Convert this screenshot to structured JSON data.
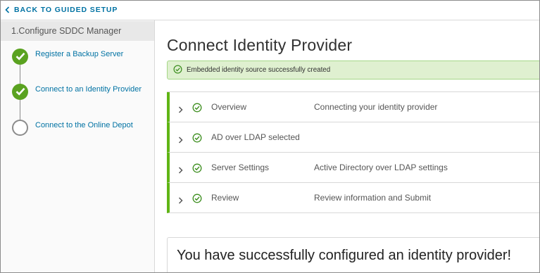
{
  "header": {
    "back_label": "BACK TO GUIDED SETUP"
  },
  "sidebar": {
    "section_title": "1.Configure SDDC Manager",
    "steps": [
      {
        "label": "Register a Backup Server",
        "status": "complete"
      },
      {
        "label": "Connect to an Identity Provider",
        "status": "complete"
      },
      {
        "label": "Connect to the Online Depot",
        "status": "not-started"
      }
    ]
  },
  "main": {
    "title": "Connect Identity Provider",
    "alert": "Embedded identity source successfully created",
    "accordion": [
      {
        "title": "Overview",
        "description": "Connecting your identity provider"
      },
      {
        "title": "AD over LDAP selected",
        "description": ""
      },
      {
        "title": "Server Settings",
        "description": "Active Directory over LDAP settings"
      },
      {
        "title": "Review",
        "description": "Review information and Submit"
      }
    ],
    "success_message": "You have successfully configured an identity provider!"
  },
  "colors": {
    "link": "#0072a3",
    "success": "#60b515",
    "alert_bg": "#dff0d0"
  },
  "icons": {
    "back": "chevron-left-icon",
    "step_done": "checkmark-circle-icon",
    "step_todo": "empty-circle-icon",
    "row_expand": "chevron-right-icon",
    "row_status": "check-circle-icon"
  }
}
